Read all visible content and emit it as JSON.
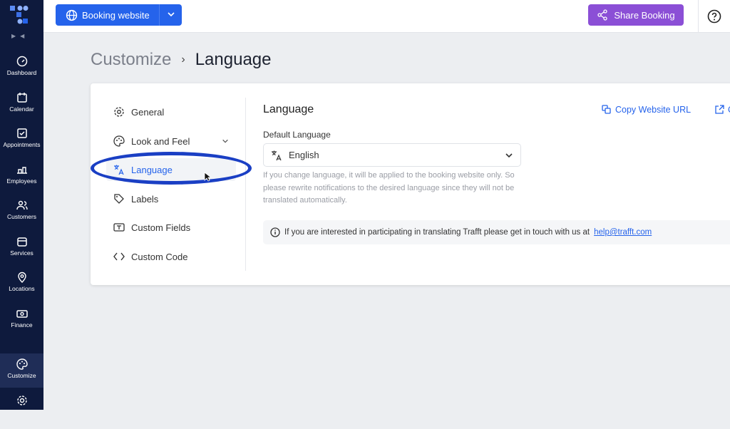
{
  "sidebar": {
    "items": [
      {
        "label": "Dashboard",
        "icon": "gauge-icon"
      },
      {
        "label": "Calendar",
        "icon": "calendar-icon"
      },
      {
        "label": "Appointments",
        "icon": "checkbox-icon"
      },
      {
        "label": "Employees",
        "icon": "employees-icon"
      },
      {
        "label": "Customers",
        "icon": "users-icon"
      },
      {
        "label": "Services",
        "icon": "box-icon"
      },
      {
        "label": "Locations",
        "icon": "pin-icon"
      },
      {
        "label": "Finance",
        "icon": "cash-icon"
      },
      {
        "label": "Customize",
        "icon": "palette-icon",
        "active": true
      },
      {
        "label": "",
        "icon": "gear-icon"
      }
    ]
  },
  "topbar": {
    "booking_label": "Booking website",
    "share_label": "Share Booking",
    "accent": "#2563eb",
    "share_color": "#8b4fd6"
  },
  "breadcrumb": {
    "parent": "Customize",
    "current": "Language"
  },
  "menu": {
    "items": [
      {
        "label": "General",
        "icon": "gear-icon"
      },
      {
        "label": "Look and Feel",
        "icon": "palette-icon"
      },
      {
        "label": "Language",
        "icon": "translate-icon",
        "selected": true
      },
      {
        "label": "Labels",
        "icon": "tag-icon"
      },
      {
        "label": "Custom Fields",
        "icon": "text-field-icon"
      },
      {
        "label": "Custom Code",
        "icon": "code-icon"
      }
    ]
  },
  "content": {
    "title": "Language",
    "copy_url": "Copy Website URL",
    "open_partial": "O",
    "default_language_label": "Default Language",
    "default_language_value": "English",
    "hint": "If you change language, it will be applied to the booking website only. So please rewrite notifications to the desired language since they will not be translated automatically.",
    "info_text": "If you are interested in participating in translating Trafft please get in touch with us at",
    "info_email": "help@trafft.com"
  }
}
